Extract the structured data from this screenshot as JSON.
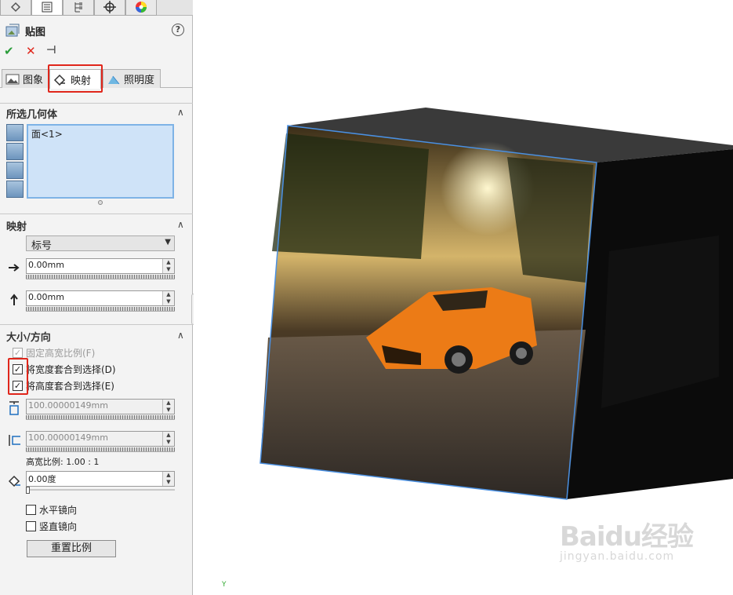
{
  "pm": {
    "title": "贴图",
    "help": "?",
    "subtabs": [
      "图象",
      "映射",
      "照明度"
    ]
  },
  "selection": {
    "title": "所选几何体",
    "items": [
      "面<1>"
    ]
  },
  "mapping": {
    "title": "映射",
    "type_value": "标号",
    "horizontal_value": "0.00mm",
    "vertical_value": "0.00mm"
  },
  "size": {
    "title": "大小/方向",
    "fixed_ratio_label": "固定高宽比例(F)",
    "fit_width_label": "将宽度套合到选择(D)",
    "fit_height_label": "将高度套合到选择(E)",
    "width_value": "100.00000149mm",
    "height_value": "100.00000149mm",
    "ratio_text": "高宽比例: 1.00 : 1",
    "angle_value": "0.00度",
    "mirror_h_label": "水平镜向",
    "mirror_v_label": "竖直镜向",
    "reset_label": "重置比例"
  },
  "watermark": {
    "logo": "Baidu经验",
    "url": "jingyan.baidu.com"
  },
  "colors": {
    "accent_red": "#e0261b",
    "selection_blue": "#cfe3f8",
    "check_green": "#2a9d3a"
  }
}
